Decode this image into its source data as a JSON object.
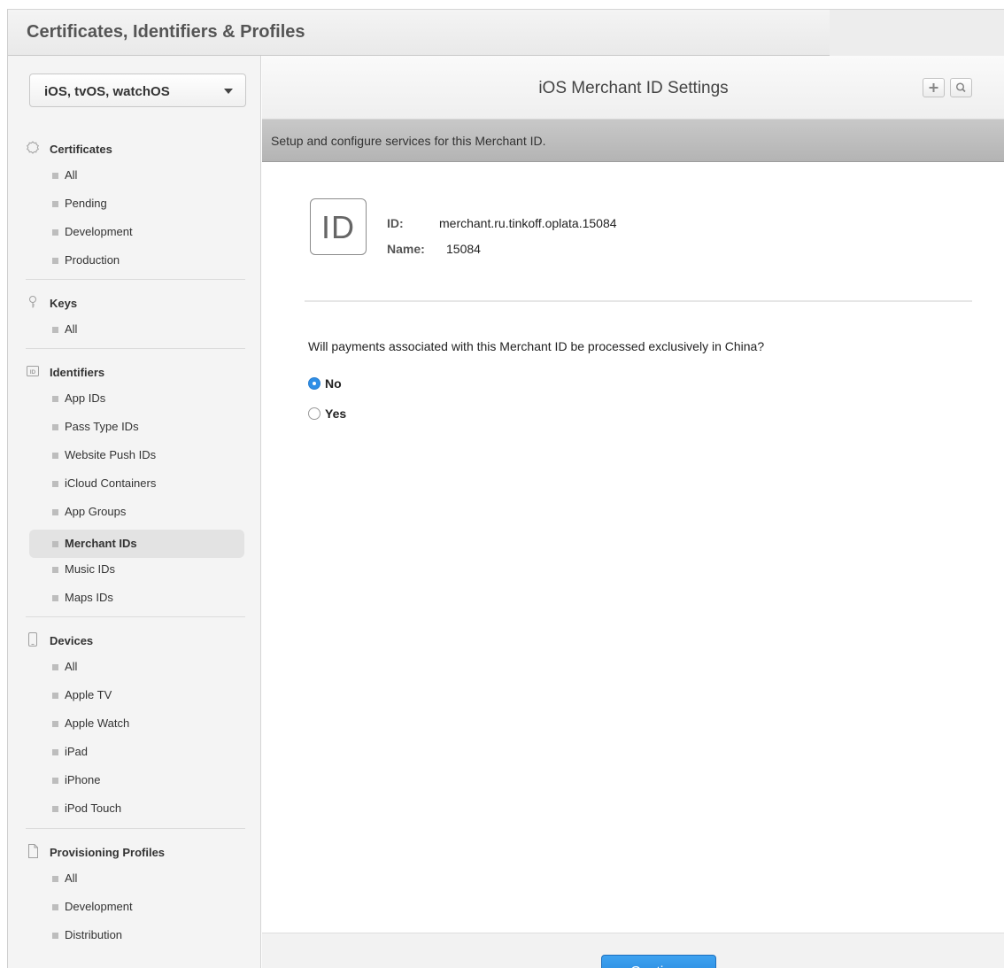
{
  "app": {
    "title": "Certificates, Identifiers & Profiles"
  },
  "sidebar": {
    "platform": "iOS, tvOS, watchOS",
    "sections": [
      {
        "title": "Certificates",
        "icon": "certificate-icon",
        "items": [
          "All",
          "Pending",
          "Development",
          "Production"
        ]
      },
      {
        "title": "Keys",
        "icon": "key-icon",
        "items": [
          "All"
        ]
      },
      {
        "title": "Identifiers",
        "icon": "id-badge-icon",
        "items": [
          "App IDs",
          "Pass Type IDs",
          "Website Push IDs",
          "iCloud Containers",
          "App Groups",
          "Merchant IDs",
          "Music IDs",
          "Maps IDs"
        ]
      },
      {
        "title": "Devices",
        "icon": "device-icon",
        "items": [
          "All",
          "Apple TV",
          "Apple Watch",
          "iPad",
          "iPhone",
          "iPod Touch"
        ]
      },
      {
        "title": "Provisioning Profiles",
        "icon": "document-icon",
        "items": [
          "All",
          "Development",
          "Distribution"
        ]
      }
    ],
    "active_item": "Merchant IDs"
  },
  "main": {
    "title": "iOS Merchant ID Settings",
    "subheader": "Setup and configure services for this Merchant ID.",
    "id_icon_text": "ID",
    "id_label": "ID:",
    "id_value": "merchant.ru.tinkoff.oplata.15084",
    "name_label": "Name:",
    "name_value": "15084",
    "question": "Will payments associated with this Merchant ID be processed exclusively in China?",
    "options": [
      {
        "label": "No",
        "checked": true
      },
      {
        "label": "Yes",
        "checked": false
      }
    ],
    "continue_label": "Continue"
  },
  "colors": {
    "accent": "#2e8ee6",
    "subheader_bg": "#bdbdbd"
  }
}
